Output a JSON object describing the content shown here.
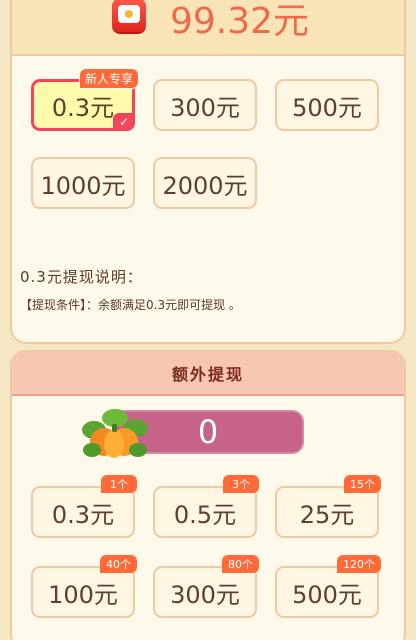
{
  "balance": {
    "amount_text": "99.32元"
  },
  "withdraw_options": [
    {
      "label": "0.3元",
      "selected": true
    },
    {
      "label": "300元"
    },
    {
      "label": "500元"
    },
    {
      "label": "1000元"
    },
    {
      "label": "2000元"
    }
  ],
  "newbie_tag": "新人专享",
  "description": {
    "title": "0.3元提现说明：",
    "condition": "【提现条件】：余额满足0.3元即可提现 。"
  },
  "extra": {
    "header": "额外提现",
    "progress_value": "0",
    "options": [
      {
        "label": "0.3元",
        "count": "1个"
      },
      {
        "label": "0.5元",
        "count": "3个"
      },
      {
        "label": "25元",
        "count": "15个"
      },
      {
        "label": "100元",
        "count": "40个"
      },
      {
        "label": "300元",
        "count": "80个"
      },
      {
        "label": "500元",
        "count": "120个"
      }
    ]
  },
  "colors": {
    "accent": "#f06a4a",
    "selected_border": "#f3455b",
    "tag": "#ff6a38",
    "progress": "#c7628a"
  }
}
